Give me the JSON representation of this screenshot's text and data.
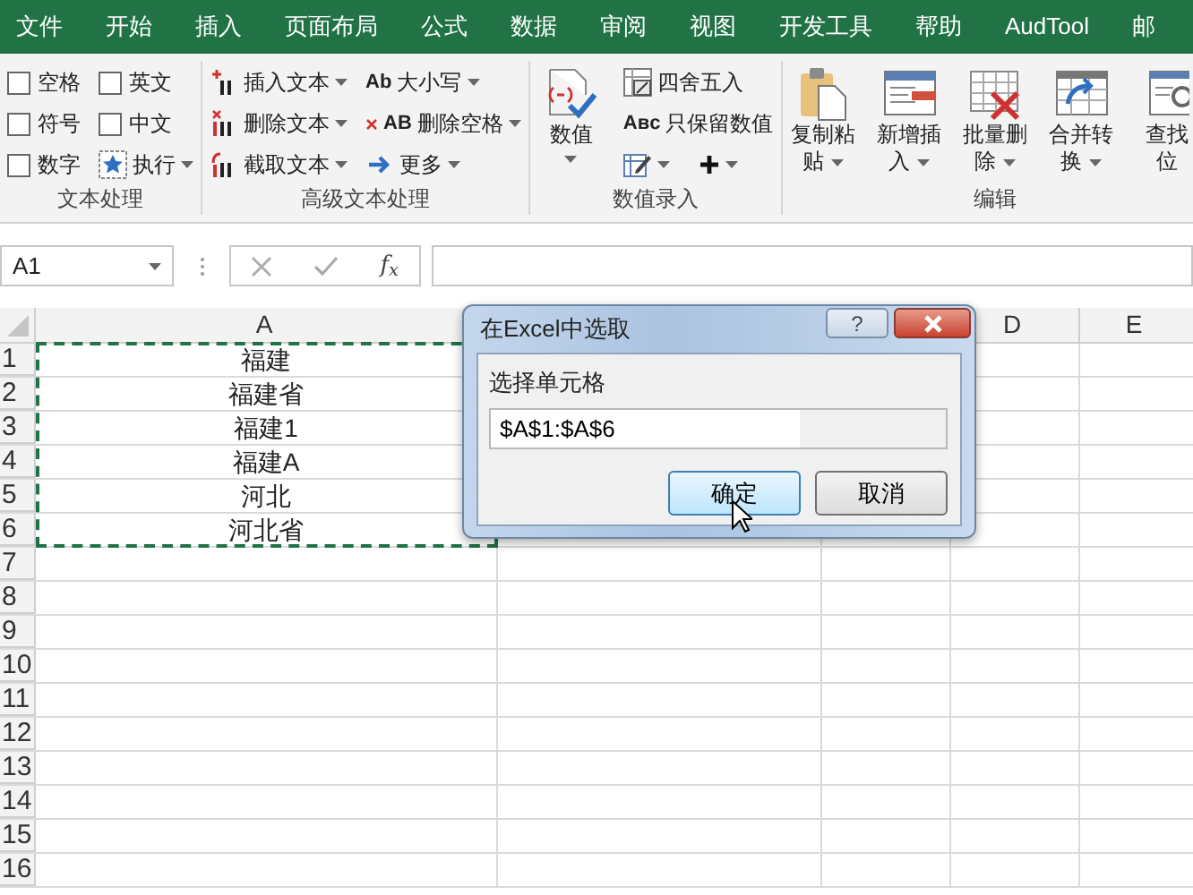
{
  "tabs": [
    {
      "label": "文件"
    },
    {
      "label": "开始"
    },
    {
      "label": "插入"
    },
    {
      "label": "页面布局"
    },
    {
      "label": "公式"
    },
    {
      "label": "数据"
    },
    {
      "label": "审阅"
    },
    {
      "label": "视图"
    },
    {
      "label": "开发工具"
    },
    {
      "label": "帮助"
    },
    {
      "label": "AudTool"
    },
    {
      "label": "邮"
    }
  ],
  "ribbon": {
    "groups": [
      {
        "label": "文本处理",
        "columns": [
          [
            {
              "kind": "checkbox",
              "label": "空格",
              "checked": false
            },
            {
              "kind": "checkbox",
              "label": "符号",
              "checked": false
            },
            {
              "kind": "checkbox",
              "label": "数字",
              "checked": false
            }
          ],
          [
            {
              "kind": "checkbox",
              "label": "英文",
              "checked": false
            },
            {
              "kind": "checkbox",
              "label": "中文",
              "checked": false
            },
            {
              "kind": "small",
              "label": "执行",
              "dropdown": true
            }
          ]
        ]
      },
      {
        "label": "高级文本处理",
        "columns": [
          [
            {
              "kind": "small",
              "label": "插入文本",
              "dropdown": true
            },
            {
              "kind": "small",
              "label": "删除文本",
              "dropdown": true
            },
            {
              "kind": "small",
              "label": "截取文本",
              "dropdown": true
            }
          ],
          [
            {
              "kind": "small",
              "label": "大小写",
              "glyph": "Ab",
              "dropdown": true
            },
            {
              "kind": "small",
              "label": "删除空格",
              "glyph": "AB",
              "dropdown": true
            },
            {
              "kind": "small",
              "label": "更多",
              "dropdown": true
            }
          ]
        ]
      },
      {
        "label": "数值录入",
        "columns": [
          [
            {
              "kind": "large",
              "lines": [
                "数值"
              ],
              "dropdown": true
            }
          ],
          [
            {
              "kind": "small",
              "label": "四舍五入",
              "dropdown": false
            },
            {
              "kind": "small",
              "label": "只保留数值",
              "glyph": "Aʙᴄ",
              "dropdown": false
            },
            {
              "kind": "iconrow",
              "buttons": [
                {
                  "dropdown": true
                },
                {
                  "dropdown": true
                }
              ]
            }
          ]
        ]
      },
      {
        "label": "编辑",
        "columns": [
          [
            {
              "kind": "large",
              "lines": [
                "复制粘",
                "贴"
              ],
              "dropdown": true
            }
          ],
          [
            {
              "kind": "large",
              "lines": [
                "新增插",
                "入"
              ],
              "dropdown": true
            }
          ],
          [
            {
              "kind": "large",
              "lines": [
                "批量删",
                "除"
              ],
              "dropdown": true
            }
          ],
          [
            {
              "kind": "large",
              "lines": [
                "合并转",
                "换"
              ],
              "dropdown": true
            }
          ],
          [
            {
              "kind": "large",
              "lines": [
                "查找",
                "位"
              ],
              "dropdown": false
            }
          ]
        ]
      }
    ]
  },
  "formula_bar": {
    "name_box": "A1",
    "fx": "f$_{x}$"
  },
  "sheet": {
    "columns": [
      {
        "label": "A"
      },
      {},
      {},
      {
        "label": "D"
      },
      {
        "label": "E"
      }
    ],
    "rows": [
      {
        "number": "1",
        "cells": [
          "福建"
        ]
      },
      {
        "number": "2",
        "cells": [
          "福建省"
        ]
      },
      {
        "number": "3",
        "cells": [
          "福建1"
        ]
      },
      {
        "number": "4",
        "cells": [
          "福建A"
        ]
      },
      {
        "number": "5",
        "cells": [
          "河北"
        ]
      },
      {
        "number": "6",
        "cells": [
          "河北省"
        ]
      },
      {
        "number": "7"
      },
      {
        "number": "8"
      },
      {
        "number": "9"
      },
      {
        "number": "10"
      },
      {
        "number": "11"
      },
      {
        "number": "12"
      },
      {
        "number": "13"
      },
      {
        "number": "14"
      },
      {
        "number": "15"
      },
      {
        "number": "16"
      }
    ]
  },
  "dialog": {
    "title": "在Excel中选取",
    "help": "?",
    "field_label": "选择单元格",
    "value": "$A$1:$A$6",
    "buttons": [
      {
        "label": "确定",
        "hovered": true
      },
      {
        "label": "取消",
        "hovered": false
      }
    ]
  }
}
